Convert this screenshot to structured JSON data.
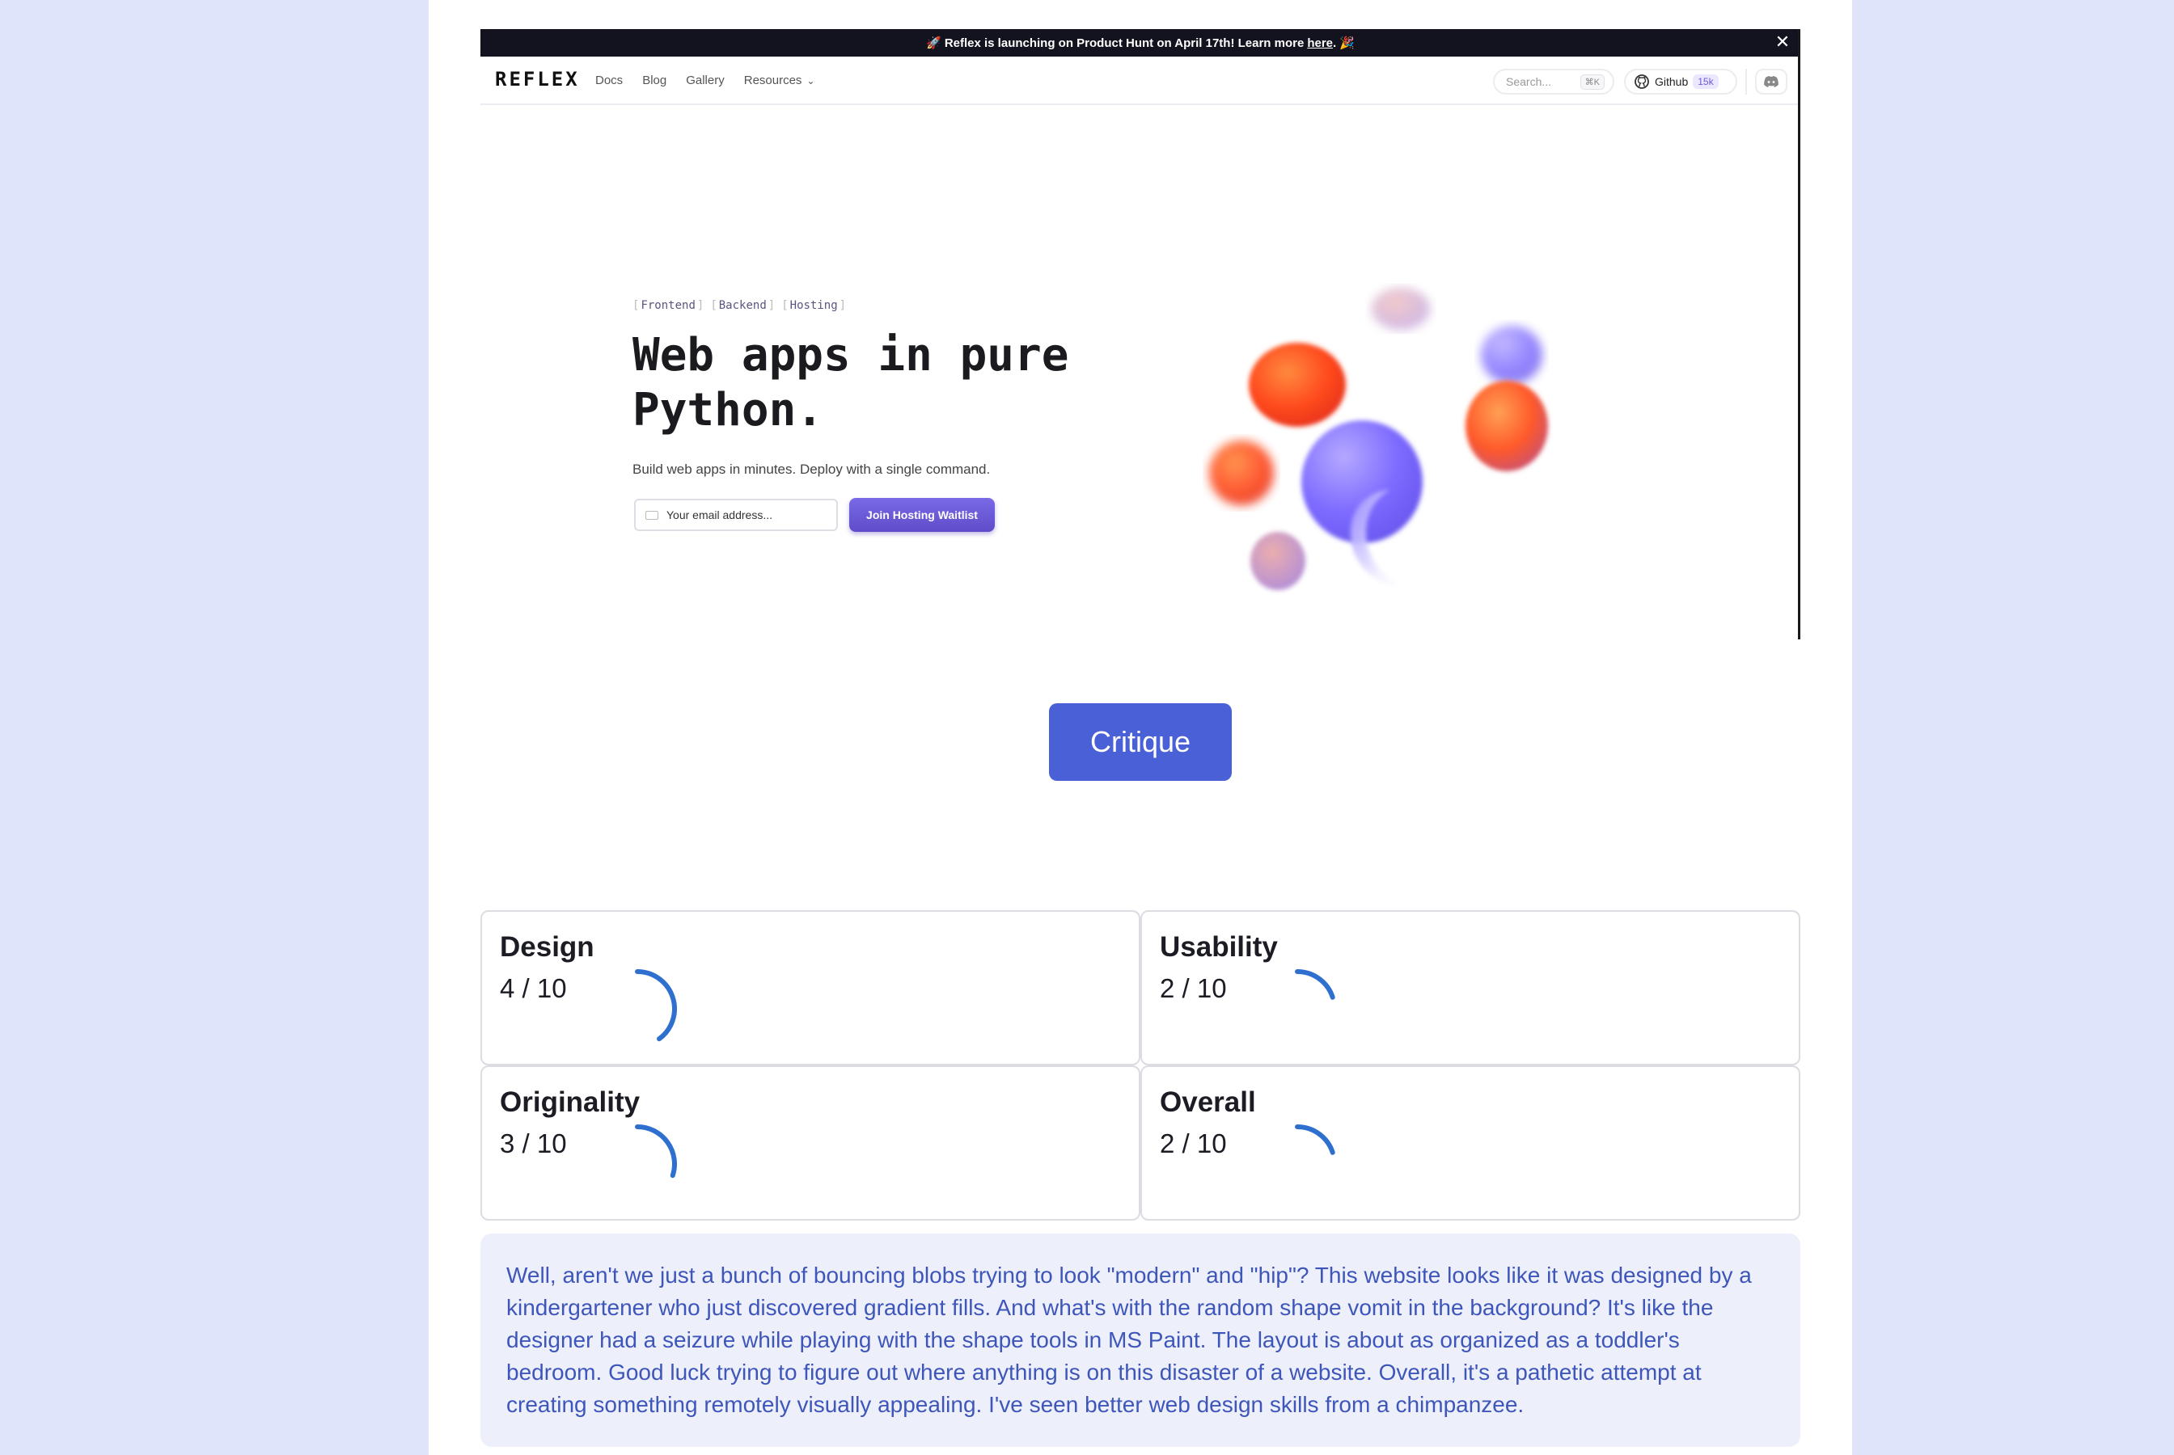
{
  "screenshot": {
    "banner": {
      "text": "🚀 Reflex is launching on Product Hunt on April 17th! Learn more",
      "link": "here",
      "suffix": ". 🎉",
      "close": "✕"
    },
    "nav": {
      "logo": "REFLEX",
      "links": [
        "Docs",
        "Blog",
        "Gallery",
        "Resources"
      ],
      "search_placeholder": "Search...",
      "search_shortcut": "⌘K",
      "github_label": "Github",
      "github_stars": "15k"
    },
    "hero": {
      "tags": [
        "Frontend",
        "Backend",
        "Hosting"
      ],
      "headline": "Web apps in pure Python.",
      "subtitle": "Build web apps in minutes. Deploy with a single command.",
      "email_placeholder": "Your email address...",
      "cta": "Join Hosting Waitlist"
    }
  },
  "critique_button": "Critique",
  "scores": [
    {
      "category": "Design",
      "score": "4 / 10",
      "value": 4
    },
    {
      "category": "Usability",
      "score": "2 / 10",
      "value": 2
    },
    {
      "category": "Originality",
      "score": "3 / 10",
      "value": 3
    },
    {
      "category": "Overall",
      "score": "2 / 10",
      "value": 2
    }
  ],
  "ring_color": "#2f6fcf",
  "critique_text": "Well, aren't we just a bunch of bouncing blobs trying to look \"modern\" and \"hip\"? This website looks like it was designed by a kindergartener who just discovered gradient fills. And what's with the random shape vomit in the background? It's like the designer had a seizure while playing with the shape tools in MS Paint. The layout is about as organized as a toddler's bedroom. Good luck trying to figure out where anything is on this disaster of a website. Overall, it's a pathetic attempt at creating something remotely visually appealing. I've seen better web design skills from a chimpanzee."
}
